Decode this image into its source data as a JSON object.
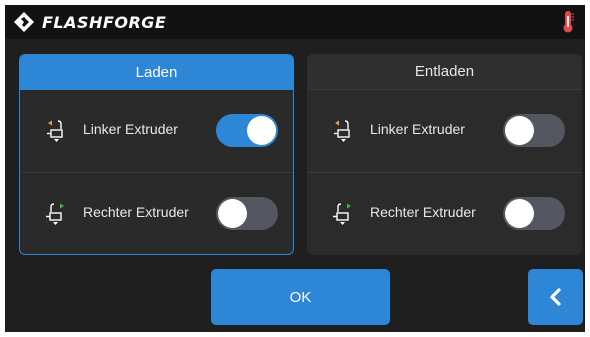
{
  "header": {
    "brand": "FLASHFORGE",
    "logo_icon": "flashforge-logo-icon",
    "temperature_icon": "thermometer-icon",
    "temperature_color": "#e5484d"
  },
  "load_panel": {
    "title": "Laden",
    "selected": true,
    "rows": [
      {
        "label": "Linker Extruder",
        "icon": "left-extruder-load-icon",
        "enabled": true
      },
      {
        "label": "Rechter Extruder",
        "icon": "right-extruder-load-icon",
        "enabled": false
      }
    ]
  },
  "unload_panel": {
    "title": "Entladen",
    "selected": false,
    "rows": [
      {
        "label": "Linker Extruder",
        "icon": "left-extruder-unload-icon",
        "enabled": false
      },
      {
        "label": "Rechter Extruder",
        "icon": "right-extruder-unload-icon",
        "enabled": false
      }
    ]
  },
  "footer": {
    "ok_label": "OK",
    "back_icon": "chevron-left-icon"
  },
  "colors": {
    "accent": "#2e86d6",
    "background": "#1f1f1f",
    "panel": "#2b2b2b",
    "toggle_off": "#555760",
    "left_extruder_marker": "#f0a040",
    "right_extruder_marker": "#4caf50"
  }
}
